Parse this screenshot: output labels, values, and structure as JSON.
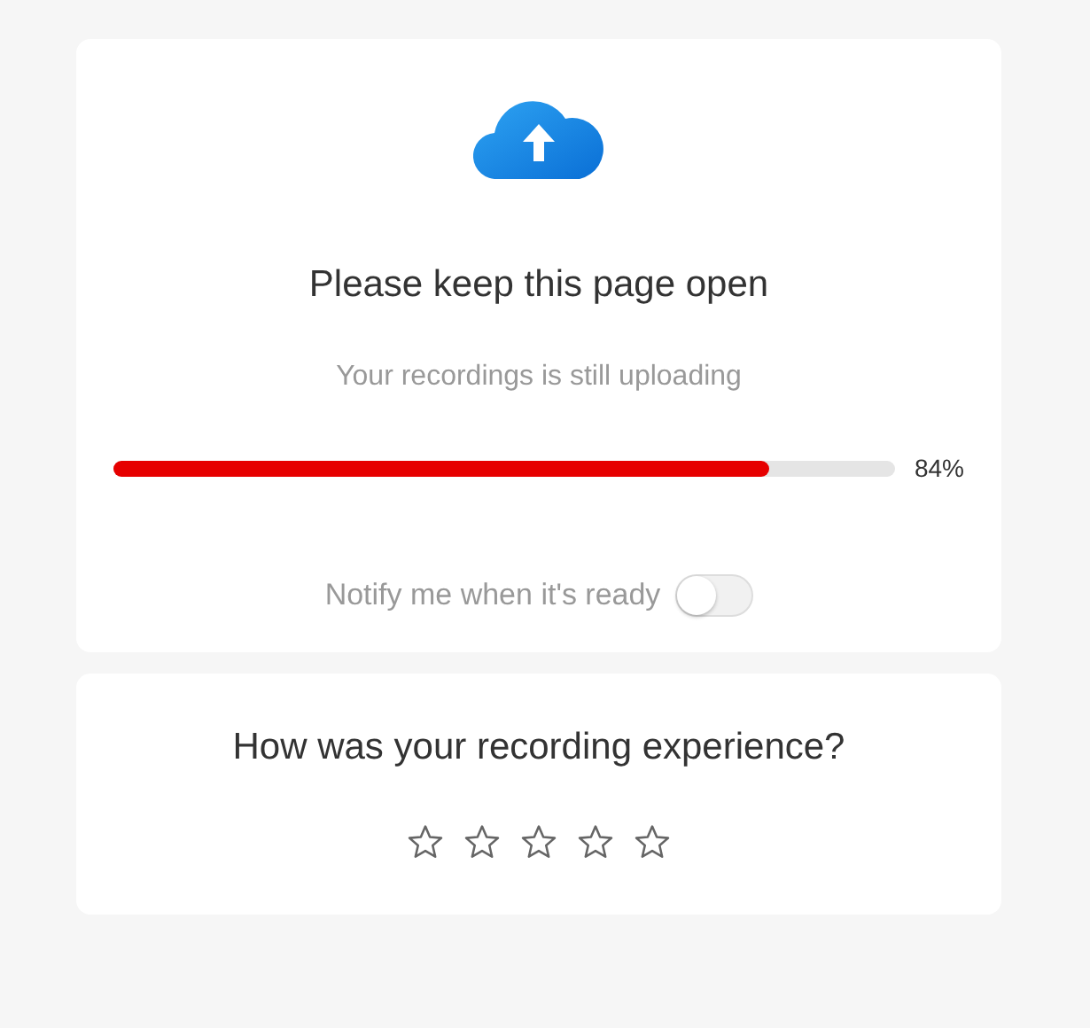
{
  "upload": {
    "title": "Please keep this page open",
    "subtitle": "Your recordings is still uploading",
    "progress": {
      "level": 0.84,
      "reading": "84%"
    },
    "notify": {
      "label": "Notify me when it's ready",
      "on": false
    }
  },
  "rating": {
    "question": "How was your recording experience?",
    "stars": 0
  }
}
